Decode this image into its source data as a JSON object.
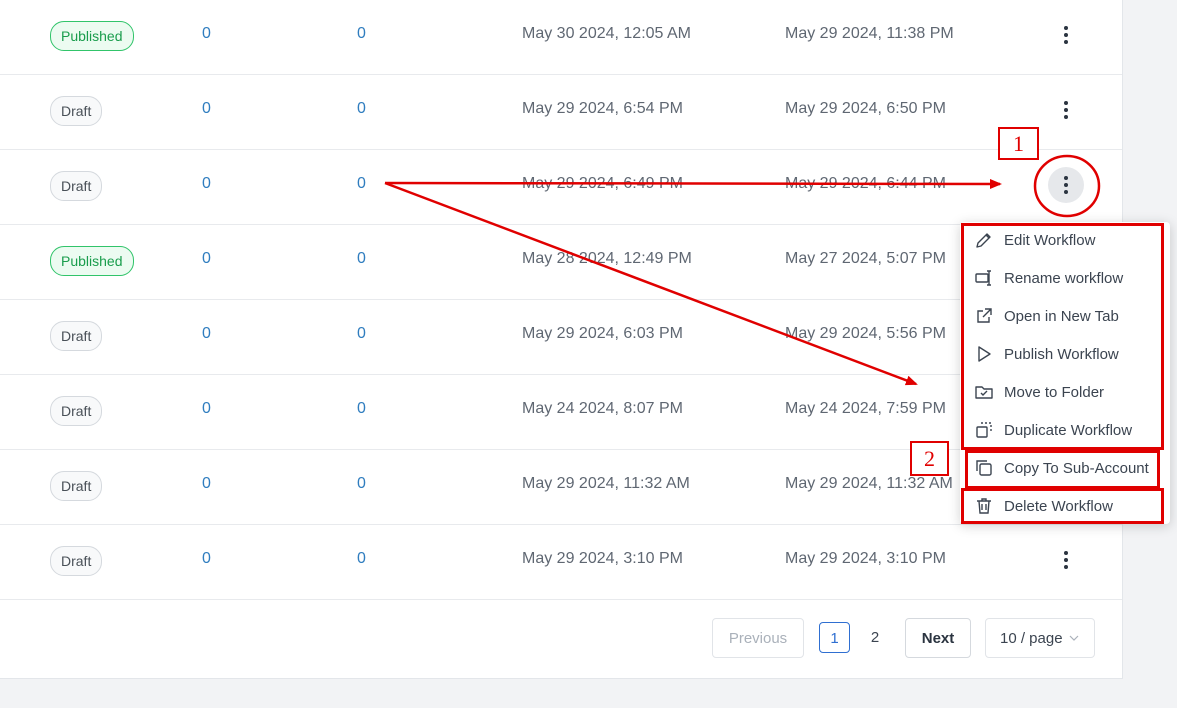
{
  "rows": [
    {
      "status": "Published",
      "count_a": "0",
      "count_b": "0",
      "updated": "May 30 2024, 12:05 AM",
      "created": "May 29 2024, 11:38 PM"
    },
    {
      "status": "Draft",
      "count_a": "0",
      "count_b": "0",
      "updated": "May 29 2024, 6:54 PM",
      "created": "May 29 2024, 6:50 PM"
    },
    {
      "status": "Draft",
      "count_a": "0",
      "count_b": "0",
      "updated": "May 29 2024, 6:49 PM",
      "created": "May 29 2024, 6:44 PM"
    },
    {
      "status": "Published",
      "count_a": "0",
      "count_b": "0",
      "updated": "May 28 2024, 12:49 PM",
      "created": "May 27 2024, 5:07 PM"
    },
    {
      "status": "Draft",
      "count_a": "0",
      "count_b": "0",
      "updated": "May 29 2024, 6:03 PM",
      "created": "May 29 2024, 5:56 PM"
    },
    {
      "status": "Draft",
      "count_a": "0",
      "count_b": "0",
      "updated": "May 24 2024, 8:07 PM",
      "created": "May 24 2024, 7:59 PM"
    },
    {
      "status": "Draft",
      "count_a": "0",
      "count_b": "0",
      "updated": "May 29 2024, 11:32 AM",
      "created": "May 29 2024, 11:32 AM"
    },
    {
      "status": "Draft",
      "count_a": "0",
      "count_b": "0",
      "updated": "May 29 2024, 3:10 PM",
      "created": "May 29 2024, 3:10 PM"
    }
  ],
  "menu": {
    "items": [
      {
        "label": "Edit Workflow",
        "icon": "pencil-icon"
      },
      {
        "label": "Rename workflow",
        "icon": "rename-icon"
      },
      {
        "label": "Open in New Tab",
        "icon": "external-link-icon"
      },
      {
        "label": "Publish Workflow",
        "icon": "play-icon"
      },
      {
        "label": "Move to Folder",
        "icon": "folder-move-icon"
      },
      {
        "label": "Duplicate Workflow",
        "icon": "duplicate-icon"
      },
      {
        "label": "Copy To Sub-Account",
        "icon": "copy-icon"
      },
      {
        "label": "Delete Workflow",
        "icon": "trash-icon"
      }
    ]
  },
  "pagination": {
    "previous": "Previous",
    "pages": [
      "1",
      "2"
    ],
    "current_page": "1",
    "next": "Next",
    "page_size": "10 / page"
  },
  "annotations": {
    "step1": "1",
    "step2": "2",
    "color": "#e00000"
  },
  "colors": {
    "published": "#1a9d4d",
    "link": "#2f7dbf"
  }
}
